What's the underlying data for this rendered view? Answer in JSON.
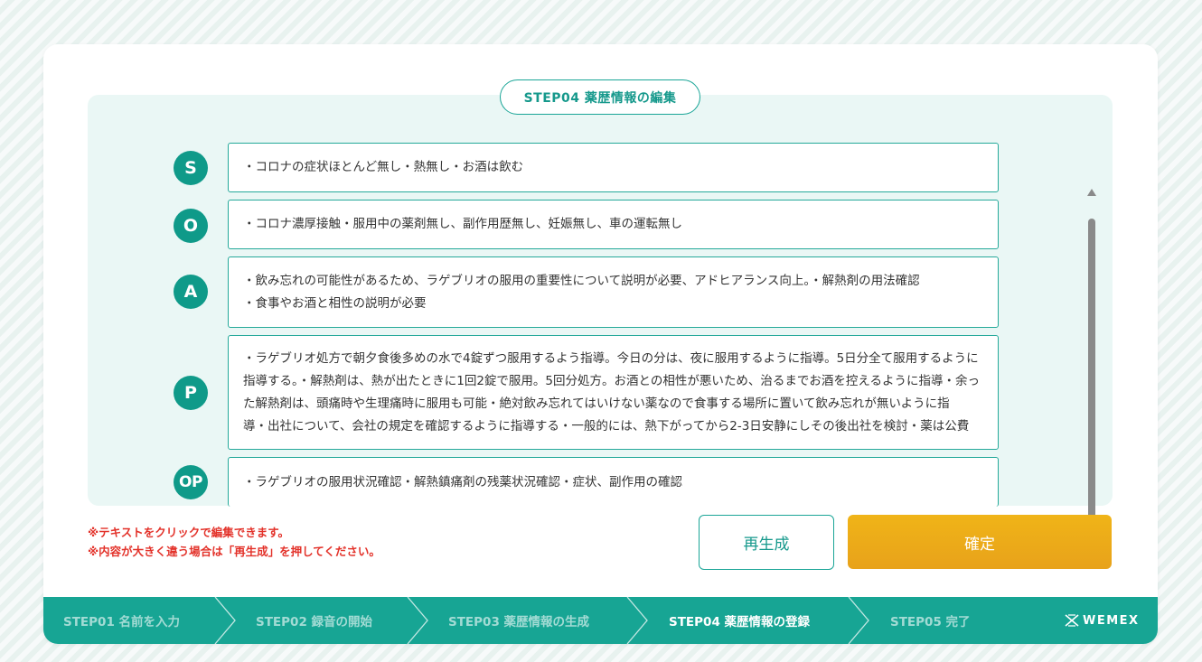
{
  "step_title": "STEP04 薬歴情報の編集",
  "soap": [
    {
      "label": "S",
      "text": "・コロナの症状ほとんど無し・熱無し・お酒は飲む"
    },
    {
      "label": "O",
      "text": "・コロナ濃厚接触・服用中の薬剤無し、副作用歴無し、妊娠無し、車の運転無し"
    },
    {
      "label": "A",
      "text": "・飲み忘れの可能性があるため、ラゲブリオの服用の重要性について説明が必要、アドヒアランス向上。・解熱剤の用法確認\n・食事やお酒と相性の説明が必要"
    },
    {
      "label": "P",
      "text": "・ラゲブリオ処方で朝夕食後多めの水で4錠ずつ服用するよう指導。今日の分は、夜に服用するように指導。5日分全て服用するように\n指導する。・解熱剤は、熱が出たときに1回2錠で服用。5回分処方。お酒との相性が悪いため、治るまでお酒を控えるように指導・余っ\nた解熱剤は、頭痛時や生理痛時に服用も可能・絶対飲み忘れてはいけない薬なので食事する場所に置いて飲み忘れが無いように指\n導・出社について、会社の規定を確認するように指導する・一般的には、熱下がってから2-3日安静にしその後出社を検討・薬は公費"
    },
    {
      "label": "OP",
      "text": "・ラゲブリオの服用状況確認・解熱鎮痛剤の残薬状況確認・症状、副作用の確認"
    }
  ],
  "notes": [
    "※テキストをクリックで編集できます。",
    "※内容が大きく違う場合は「再生成」を押してください。"
  ],
  "buttons": {
    "regenerate": "再生成",
    "confirm": "確定"
  },
  "steps": [
    {
      "label": "STEP01 名前を入力",
      "active": false
    },
    {
      "label": "STEP02 録音の開始",
      "active": false
    },
    {
      "label": "STEP03 薬歴情報の生成",
      "active": false
    },
    {
      "label": "STEP04 薬歴情報の登録",
      "active": true
    },
    {
      "label": "STEP05 完了",
      "active": false
    }
  ],
  "logo": "WEMEX",
  "colors": {
    "primary": "#17a594",
    "accent": "#f0b418",
    "warning": "#e3322a",
    "panel": "#eaf7f5"
  }
}
